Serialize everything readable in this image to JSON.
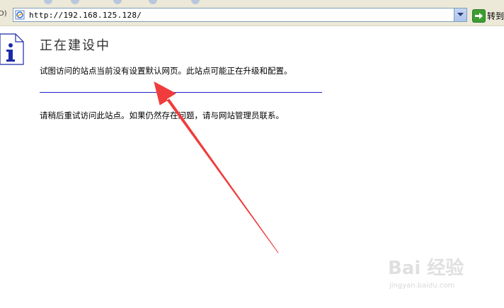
{
  "browser": {
    "address_label": "D)",
    "url": "http://192.168.125.128/",
    "go_label": "转到"
  },
  "page": {
    "title": "正在建设中",
    "message_1": "试图访问的站点当前没有设置默认网页。此站点可能正在升级和配置。",
    "message_2": "请稍后重试访问此站点。如果仍然存在问题，请与网站管理员联系。"
  },
  "watermark": {
    "logo": "Bai 经验",
    "url": "jingyan.baidu.com"
  },
  "colors": {
    "divider": "#1e22c9",
    "arrow": "#f03c3c",
    "info_icon": "#1b2aa8"
  }
}
